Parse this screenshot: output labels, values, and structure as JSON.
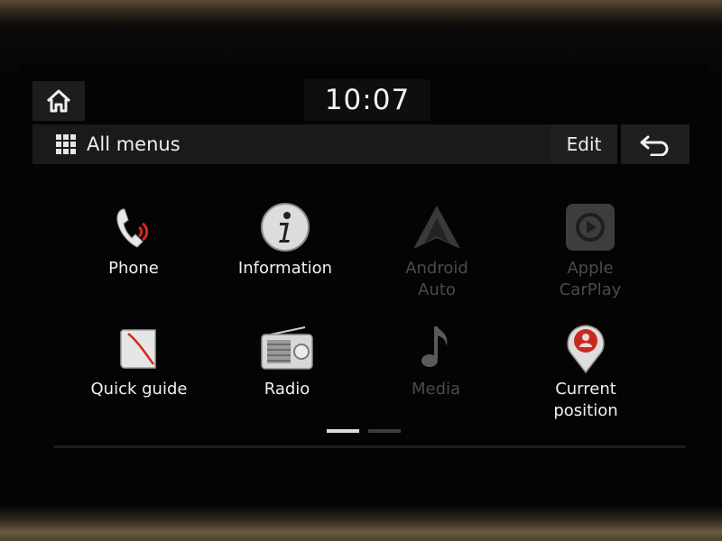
{
  "header": {
    "time": "10:07",
    "title": "All menus",
    "edit_label": "Edit"
  },
  "icons": {
    "home": "home-icon",
    "grid": "grid-icon",
    "back": "back-arrow-icon"
  },
  "menu": {
    "items": [
      {
        "label": "Phone",
        "icon": "phone-icon",
        "enabled": true
      },
      {
        "label": "Information",
        "icon": "info-icon",
        "enabled": true
      },
      {
        "label": "Android\nAuto",
        "icon": "android-auto-icon",
        "enabled": false
      },
      {
        "label": "Apple\nCarPlay",
        "icon": "carplay-icon",
        "enabled": false
      },
      {
        "label": "Quick guide",
        "icon": "guide-book-icon",
        "enabled": true
      },
      {
        "label": "Radio",
        "icon": "radio-icon",
        "enabled": true
      },
      {
        "label": "Media",
        "icon": "music-note-icon",
        "enabled": false
      },
      {
        "label": "Current\nposition",
        "icon": "location-pin-icon",
        "enabled": true
      }
    ]
  },
  "pager": {
    "pages": 2,
    "current": 1
  },
  "colors": {
    "accent_red": "#d42a1e",
    "enabled_text": "#f0f0f0",
    "disabled_text": "#4b4b4b"
  }
}
